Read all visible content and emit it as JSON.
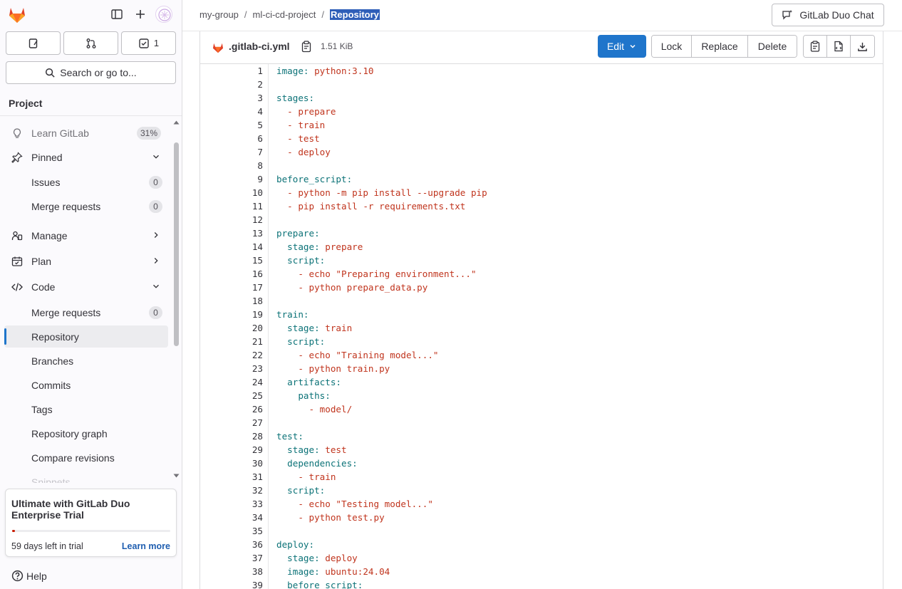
{
  "sidebar": {
    "quick": {
      "todo_count": "1"
    },
    "search_label": "Search or go to...",
    "section_title": "Project",
    "items": [
      {
        "label": "Learn GitLab",
        "badge": "31%"
      },
      {
        "label": "Pinned"
      },
      {
        "label": "Issues",
        "count": "0"
      },
      {
        "label": "Merge requests",
        "count": "0"
      },
      {
        "label": "Manage"
      },
      {
        "label": "Plan"
      },
      {
        "label": "Code"
      },
      {
        "label": "Merge requests",
        "count": "0"
      },
      {
        "label": "Repository"
      },
      {
        "label": "Branches"
      },
      {
        "label": "Commits"
      },
      {
        "label": "Tags"
      },
      {
        "label": "Repository graph"
      },
      {
        "label": "Compare revisions"
      },
      {
        "label": "Snippets"
      }
    ],
    "trial": {
      "title": "Ultimate with GitLab Duo Enterprise Trial",
      "days_left": "59 days left in trial",
      "link": "Learn more",
      "progress": 0.02
    },
    "help_label": "Help"
  },
  "topbar": {
    "breadcrumb": [
      "my-group",
      "ml-ci-cd-project",
      "Repository"
    ],
    "duo_chat_label": "GitLab Duo Chat"
  },
  "file": {
    "name": ".gitlab-ci.yml",
    "size": "1.51 KiB",
    "edit_label": "Edit",
    "lock_label": "Lock",
    "replace_label": "Replace",
    "delete_label": "Delete"
  },
  "code_lines": [
    "image: python:3.10",
    "",
    "stages:",
    "  - prepare",
    "  - train",
    "  - test",
    "  - deploy",
    "",
    "before_script:",
    "  - python -m pip install --upgrade pip",
    "  - pip install -r requirements.txt",
    "",
    "prepare:",
    "  stage: prepare",
    "  script:",
    "    - echo \"Preparing environment...\"",
    "    - python prepare_data.py",
    "",
    "train:",
    "  stage: train",
    "  script:",
    "    - echo \"Training model...\"",
    "    - python train.py",
    "  artifacts:",
    "    paths:",
    "      - model/",
    "",
    "test:",
    "  stage: test",
    "  dependencies:",
    "    - train",
    "  script:",
    "    - echo \"Testing model...\"",
    "    - python test.py",
    "",
    "deploy:",
    "  stage: deploy",
    "  image: ubuntu:24.04",
    "  before_script:"
  ],
  "colors": {
    "accent": "#1f75cb",
    "yaml_key": "#0b7277",
    "yaml_value": "#c0341d",
    "trial_bar": "#c91c00"
  }
}
